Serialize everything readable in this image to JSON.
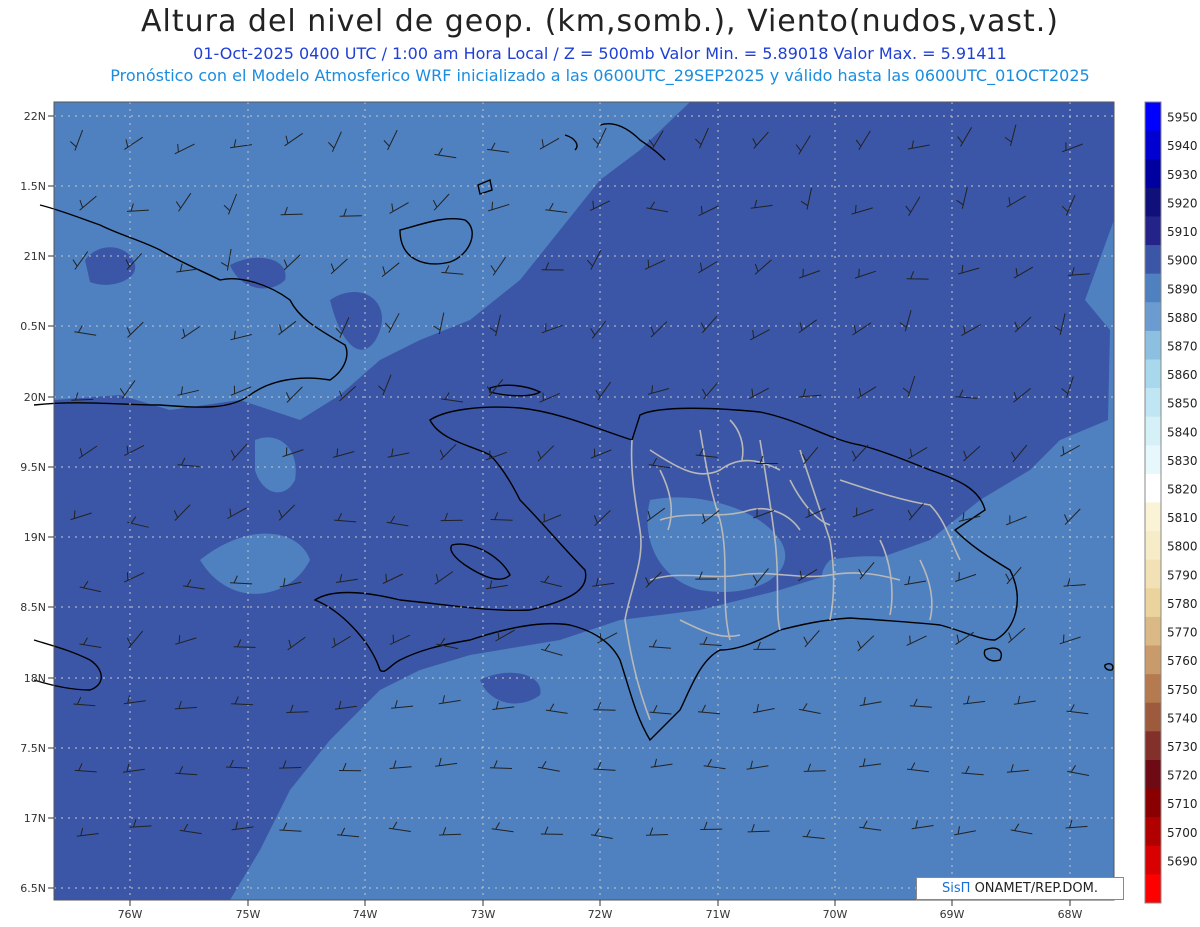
{
  "header": {
    "title": "Altura del nivel de geop. (km,somb.), Viento(nudos,vast.)",
    "line2": "01-Oct-2025  0400 UTC / 1:00 am Hora Local / Z = 500mb     Valor Min. = 5.89018  Valor Max. = 5.91411",
    "line3": "Pronóstico con el Modelo Atmosferico WRF inicializado a las 0600UTC_29SEP2025 y válido hasta las  0600UTC_01OCT2025"
  },
  "map": {
    "lat_labels": [
      "22N",
      "1.5N",
      "21N",
      "0.5N",
      "20N",
      "9.5N",
      "19N",
      "8.5N",
      "18N",
      "7.5N",
      "17N",
      "6.5N"
    ],
    "lon_labels": [
      "76W",
      "75W",
      "74W",
      "73W",
      "72W",
      "71W",
      "70W",
      "69W",
      "68W"
    ],
    "field_colors": {
      "5900": "#3b56a6",
      "5890": "#4f80bf"
    }
  },
  "colorbar": {
    "levels": [
      {
        "value": "5950",
        "color": "#0000ff"
      },
      {
        "value": "5940",
        "color": "#0000d0"
      },
      {
        "value": "5930",
        "color": "#0000a0"
      },
      {
        "value": "5920",
        "color": "#10107a"
      },
      {
        "value": "5910",
        "color": "#23238a"
      },
      {
        "value": "5900",
        "color": "#3b56a6"
      },
      {
        "value": "5890",
        "color": "#4f80bf"
      },
      {
        "value": "5880",
        "color": "#6b9bd1"
      },
      {
        "value": "5870",
        "color": "#8cbfe0"
      },
      {
        "value": "5860",
        "color": "#a8d8ec"
      },
      {
        "value": "5850",
        "color": "#bfe6f2"
      },
      {
        "value": "5840",
        "color": "#d6f0f7"
      },
      {
        "value": "5830",
        "color": "#e6f8fb"
      },
      {
        "value": "5820",
        "color": "#ffffff"
      },
      {
        "value": "5810",
        "color": "#fbf3d6"
      },
      {
        "value": "5800",
        "color": "#f7ecc8"
      },
      {
        "value": "5790",
        "color": "#f1e1b4"
      },
      {
        "value": "5780",
        "color": "#ead39c"
      },
      {
        "value": "5770",
        "color": "#dbb986"
      },
      {
        "value": "5760",
        "color": "#c99a6a"
      },
      {
        "value": "5750",
        "color": "#b67a50"
      },
      {
        "value": "5740",
        "color": "#9e5a3c"
      },
      {
        "value": "5730",
        "color": "#84302a"
      },
      {
        "value": "5720",
        "color": "#6e0a14"
      },
      {
        "value": "5710",
        "color": "#8a0000"
      },
      {
        "value": "5700",
        "color": "#b00000"
      },
      {
        "value": "5690",
        "color": "#d80000"
      },
      {
        "value": "",
        "color": "#ff0000"
      }
    ]
  },
  "credit": {
    "sis": "SisΠ",
    "text": " ONAMET/REP.DOM."
  }
}
